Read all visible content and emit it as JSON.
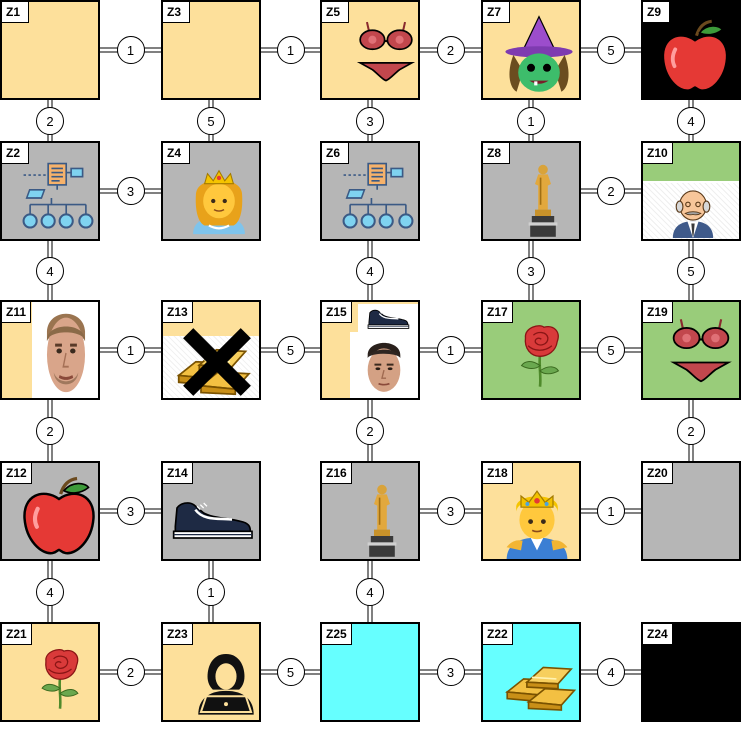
{
  "colors": {
    "yellow": "#fde09b",
    "gray": "#b6b6b6",
    "green": "#99cc7a",
    "cyan": "#66ffff",
    "black": "#000000"
  },
  "zones": {
    "z1": {
      "label": "Z1",
      "fill": "yellow"
    },
    "z3": {
      "label": "Z3",
      "fill": "yellow"
    },
    "z5": {
      "label": "Z5",
      "fill": "yellow",
      "icon": "bikini-icon"
    },
    "z7": {
      "label": "Z7",
      "fill": "yellow",
      "icon": "witch-icon"
    },
    "z9": {
      "label": "Z9",
      "fill": "black",
      "icon": "apple-icon"
    },
    "z2": {
      "label": "Z2",
      "fill": "gray",
      "icon": "hierarchy-diagram-icon"
    },
    "z4": {
      "label": "Z4",
      "fill": "gray",
      "icon": "princess-icon"
    },
    "z6": {
      "label": "Z6",
      "fill": "gray",
      "icon": "hierarchy-diagram-icon"
    },
    "z8": {
      "label": "Z8",
      "fill": "gray",
      "icon": "oscar-trophy-icon"
    },
    "z10": {
      "label": "Z10",
      "fill": "green",
      "icon": "old-man-icon"
    },
    "z11": {
      "label": "Z11",
      "fill": "yellow",
      "icon": "man-face-photo"
    },
    "z13": {
      "label": "Z13",
      "fill": "yellow",
      "icon": "gold-bars-crossed-icon"
    },
    "z15": {
      "label": "Z15",
      "fill": "yellow",
      "icon": "sneaker-and-man-face-photo"
    },
    "z17": {
      "label": "Z17",
      "fill": "green",
      "icon": "rose-icon"
    },
    "z19": {
      "label": "Z19",
      "fill": "green",
      "icon": "bikini-icon"
    },
    "z12": {
      "label": "Z12",
      "fill": "gray",
      "icon": "apple-icon"
    },
    "z14": {
      "label": "Z14",
      "fill": "gray",
      "icon": "sneaker-icon"
    },
    "z16": {
      "label": "Z16",
      "fill": "gray",
      "icon": "oscar-trophy-icon"
    },
    "z18": {
      "label": "Z18",
      "fill": "yellow",
      "icon": "prince-icon"
    },
    "z20": {
      "label": "Z20",
      "fill": "gray"
    },
    "z21": {
      "label": "Z21",
      "fill": "yellow",
      "icon": "rose-icon"
    },
    "z23": {
      "label": "Z23",
      "fill": "yellow",
      "icon": "hacker-laptop-icon"
    },
    "z25": {
      "label": "Z25",
      "fill": "cyan"
    },
    "z22": {
      "label": "Z22",
      "fill": "cyan",
      "icon": "gold-bars-icon"
    },
    "z24": {
      "label": "Z24",
      "fill": "black"
    }
  },
  "connections": [
    {
      "from": "Z1",
      "to": "Z3",
      "weight": "1"
    },
    {
      "from": "Z3",
      "to": "Z5",
      "weight": "1"
    },
    {
      "from": "Z5",
      "to": "Z7",
      "weight": "2"
    },
    {
      "from": "Z7",
      "to": "Z9",
      "weight": "5"
    },
    {
      "from": "Z2",
      "to": "Z4",
      "weight": "3"
    },
    {
      "from": "Z8",
      "to": "Z10",
      "weight": "2"
    },
    {
      "from": "Z11",
      "to": "Z13",
      "weight": "1"
    },
    {
      "from": "Z13",
      "to": "Z15",
      "weight": "5"
    },
    {
      "from": "Z15",
      "to": "Z17",
      "weight": "1"
    },
    {
      "from": "Z17",
      "to": "Z19",
      "weight": "5"
    },
    {
      "from": "Z12",
      "to": "Z14",
      "weight": "3"
    },
    {
      "from": "Z16",
      "to": "Z18",
      "weight": "3"
    },
    {
      "from": "Z18",
      "to": "Z20",
      "weight": "1"
    },
    {
      "from": "Z21",
      "to": "Z23",
      "weight": "2"
    },
    {
      "from": "Z23",
      "to": "Z25",
      "weight": "5"
    },
    {
      "from": "Z25",
      "to": "Z22",
      "weight": "3"
    },
    {
      "from": "Z22",
      "to": "Z24",
      "weight": "4"
    },
    {
      "from": "Z1",
      "to": "Z2",
      "weight": "2"
    },
    {
      "from": "Z3",
      "to": "Z4",
      "weight": "5"
    },
    {
      "from": "Z5",
      "to": "Z6",
      "weight": "3"
    },
    {
      "from": "Z7",
      "to": "Z8",
      "weight": "1"
    },
    {
      "from": "Z9",
      "to": "Z10",
      "weight": "4"
    },
    {
      "from": "Z2",
      "to": "Z11",
      "weight": "4"
    },
    {
      "from": "Z6",
      "to": "Z15",
      "weight": "4"
    },
    {
      "from": "Z8",
      "to": "Z17",
      "weight": "3"
    },
    {
      "from": "Z10",
      "to": "Z19",
      "weight": "5"
    },
    {
      "from": "Z11",
      "to": "Z12",
      "weight": "2"
    },
    {
      "from": "Z15",
      "to": "Z16",
      "weight": "2"
    },
    {
      "from": "Z19",
      "to": "Z20",
      "weight": "2"
    },
    {
      "from": "Z12",
      "to": "Z21",
      "weight": "4"
    },
    {
      "from": "Z14",
      "to": "Z23",
      "weight": "1"
    },
    {
      "from": "Z16",
      "to": "Z25",
      "weight": "4"
    }
  ]
}
